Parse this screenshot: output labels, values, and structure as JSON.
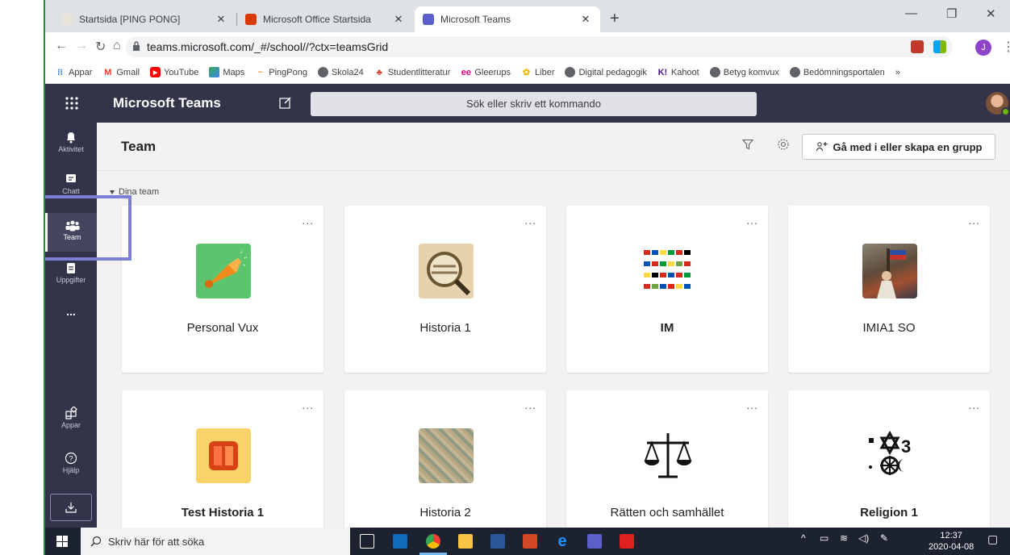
{
  "browser": {
    "tabs": [
      {
        "title": "Startsida [PING PONG]",
        "active": false
      },
      {
        "title": "Microsoft Office Startsida",
        "active": false
      },
      {
        "title": "Microsoft Teams",
        "active": true
      }
    ],
    "url": "teams.microsoft.com/_#/school//?ctx=teamsGrid",
    "profile_initial": "J",
    "bookmarks": [
      {
        "label": "Appar",
        "icon": "apps-grid-icon"
      },
      {
        "label": "Gmail",
        "icon": "gmail-icon"
      },
      {
        "label": "YouTube",
        "icon": "youtube-icon"
      },
      {
        "label": "Maps",
        "icon": "maps-icon"
      },
      {
        "label": "PingPong",
        "icon": "pingpong-icon"
      },
      {
        "label": "Skola24",
        "icon": "globe-icon"
      },
      {
        "label": "Studentlitteratur",
        "icon": "studentlitteratur-icon"
      },
      {
        "label": "Gleerups",
        "icon": "gleerups-icon"
      },
      {
        "label": "Liber",
        "icon": "liber-icon"
      },
      {
        "label": "Digital pedagogik",
        "icon": "globe-icon"
      },
      {
        "label": "Kahoot",
        "icon": "kahoot-icon"
      },
      {
        "label": "Betyg komvux",
        "icon": "globe-icon"
      },
      {
        "label": "Bedömningsportalen",
        "icon": "globe-icon"
      }
    ],
    "more_bookmarks": "»"
  },
  "teams": {
    "app_title": "Microsoft Teams",
    "search_placeholder": "Sök eller skriv ett kommando",
    "rail": {
      "activity": "Aktivitet",
      "chat": "Chatt",
      "teams": "Team",
      "assignments": "Uppgifter",
      "more": "...",
      "apps": "Appar",
      "help": "Hjälp"
    },
    "page_title": "Team",
    "join_button": "Gå med i eller skapa en grupp",
    "section_label": "Dina team",
    "cards": [
      {
        "name": "Personal Vux",
        "bold": false,
        "image": "megaphone",
        "more": "..."
      },
      {
        "name": "Historia 1",
        "bold": false,
        "image": "history-magnifier",
        "more": "..."
      },
      {
        "name": "IM",
        "bold": true,
        "image": "flags",
        "more": "..."
      },
      {
        "name": "IMIA1 SO",
        "bold": false,
        "image": "painting",
        "more": "..."
      },
      {
        "name": "Test Historia 1",
        "bold": true,
        "image": "orange-square",
        "more": "..."
      },
      {
        "name": "Historia 2",
        "bold": false,
        "image": "old-map",
        "more": "..."
      },
      {
        "name": "Rätten och samhället",
        "bold": false,
        "image": "scales",
        "more": "..."
      },
      {
        "name": "Religion 1",
        "bold": true,
        "image": "religious-symbols",
        "more": "..."
      }
    ]
  },
  "taskbar": {
    "search_placeholder": "Skriv här för att söka",
    "time": "12:37",
    "date": "2020-04-08"
  },
  "colors": {
    "teams_header": "#33344a",
    "highlight": "#7b7fd6",
    "taskbar": "#1c2230"
  }
}
